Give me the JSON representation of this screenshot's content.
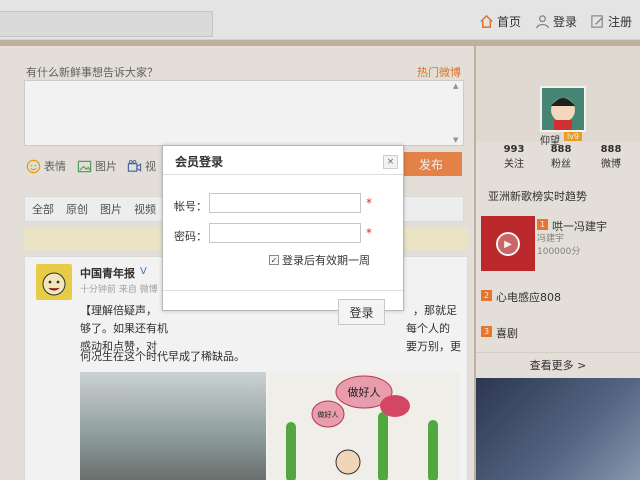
{
  "topnav": {
    "home": "首页",
    "login": "登录",
    "register": "注册"
  },
  "compose": {
    "prompt": "有什么新鲜事想告诉大家？",
    "hot_link": "热门微博",
    "tools": [
      "表情",
      "图片",
      "视"
    ],
    "publish": "发布"
  },
  "filter": {
    "items": [
      "全部",
      "原创",
      "图片",
      "视频"
    ]
  },
  "post": {
    "author": "中国青年报",
    "verified": "V",
    "meta": "十分钟前 来自 微博",
    "lines": [
      "【理解倍疑声，",
      "够了。如果还有机",
      "感动和点赞，对",
      "何况生在这个时代早成了稀缺品。"
    ],
    "line_right": [
      "，那就足",
      "每个人的",
      "要万别，更"
    ],
    "image_text": [
      "做好人",
      "做好人"
    ]
  },
  "profile": {
    "username": "仰望",
    "level": "lv9",
    "stats": [
      {
        "n": "993",
        "label": "关注"
      },
      {
        "n": "888",
        "label": "粉丝"
      },
      {
        "n": "888",
        "label": "微博"
      }
    ]
  },
  "trends": {
    "title": "亚洲新歌榜实时趋势",
    "items": [
      {
        "rank": "1",
        "name": "哄一冯建宇",
        "artist": "冯建宇",
        "score": "100000分"
      },
      {
        "rank": "2",
        "name": "心电感应808"
      },
      {
        "rank": "3",
        "name": "喜剧"
      }
    ],
    "more": "查看更多 >"
  },
  "modal": {
    "title": "会员登录",
    "close": "×",
    "account_label": "帐号：",
    "password_label": "密码：",
    "account_value": "",
    "remember": "登录后有效期一周",
    "login_btn": "登录"
  },
  "colors": {
    "accent": "#f08a4b",
    "link": "#e47a2c",
    "rank": "#f27b2f"
  }
}
